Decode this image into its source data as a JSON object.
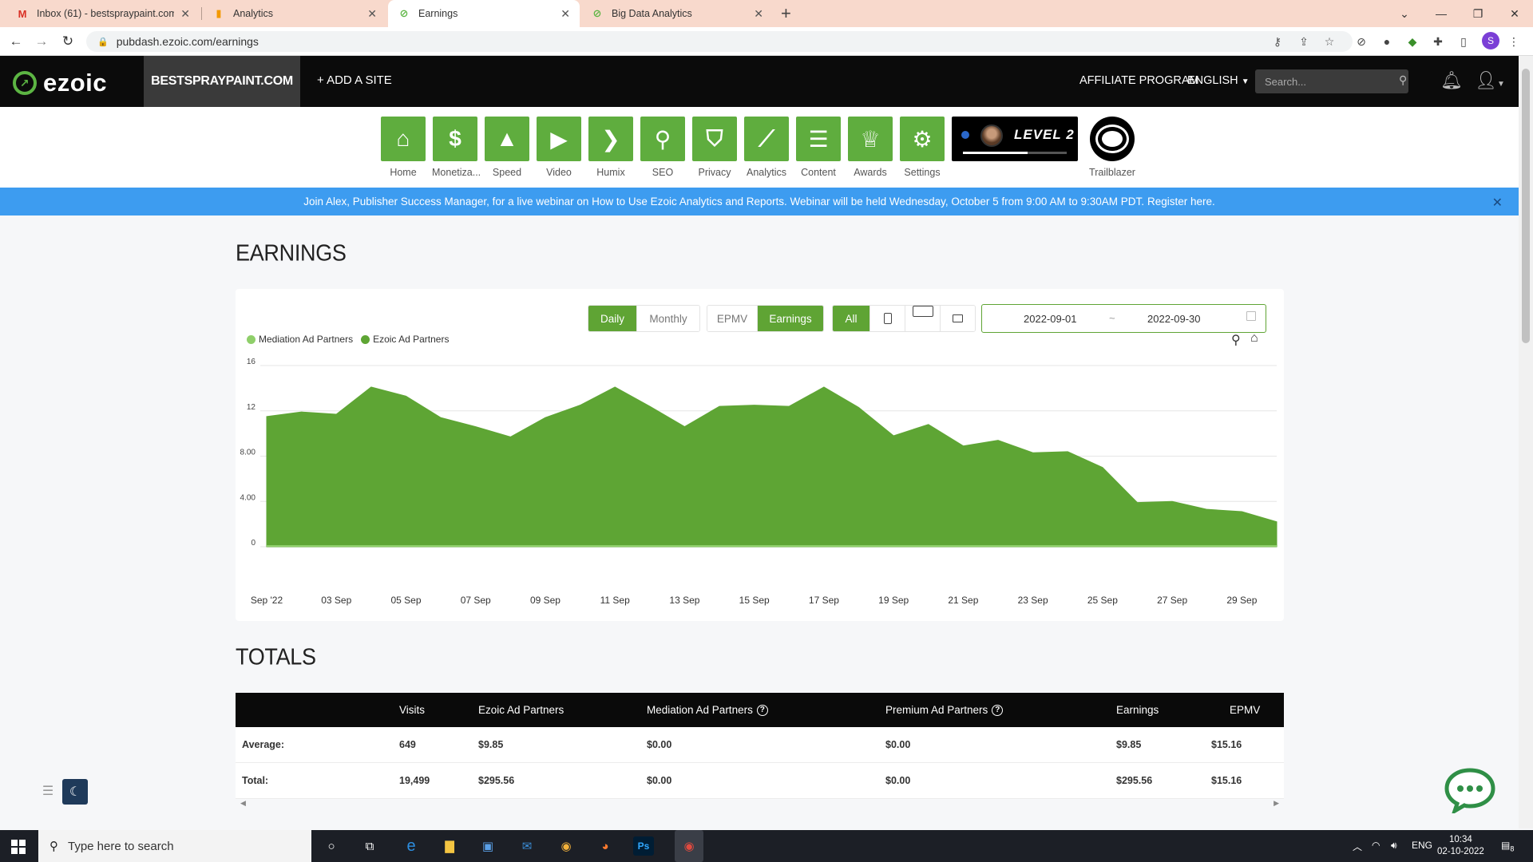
{
  "browser": {
    "tabs": [
      {
        "label": "Inbox (61) - bestspraypaint.com@",
        "icon": "gmail-icon"
      },
      {
        "label": "Analytics",
        "icon": "analytics-icon"
      },
      {
        "label": "Earnings",
        "icon": "ezoic-icon",
        "active": true
      },
      {
        "label": "Big Data Analytics",
        "icon": "ezoic-icon"
      }
    ],
    "url": "pubdash.ezoic.com/earnings",
    "profile_initial": "S"
  },
  "header": {
    "logo": "ezoic",
    "site": "BESTSPRAYPAINT.COM",
    "add_site": "+ ADD A SITE",
    "affiliate": "AFFILIATE PROGRAM",
    "language": "ENGLISH",
    "search_placeholder": "Search..."
  },
  "apps": [
    {
      "label": "Home",
      "icon": "home-icon"
    },
    {
      "label": "Monetiza...",
      "icon": "dollar-icon"
    },
    {
      "label": "Speed",
      "icon": "rocket-icon"
    },
    {
      "label": "Video",
      "icon": "video-icon"
    },
    {
      "label": "Humix",
      "icon": "humix-chevron-icon"
    },
    {
      "label": "SEO",
      "icon": "magnifier-icon"
    },
    {
      "label": "Privacy",
      "icon": "shield-icon"
    },
    {
      "label": "Analytics",
      "icon": "line-chart-icon"
    },
    {
      "label": "Content",
      "icon": "document-icon"
    },
    {
      "label": "Awards",
      "icon": "trophy-icon"
    },
    {
      "label": "Settings",
      "icon": "gear-icon"
    }
  ],
  "level": {
    "label": "LEVEL 2",
    "progress": 0.62
  },
  "trailblazer": {
    "label": "Trailblazer"
  },
  "banner": {
    "text": "Join Alex, Publisher Success Manager, for a live webinar on How to Use Ezoic Analytics and Reports. Webinar will be held Wednesday, October 5 from 9:00 AM to 9:30AM PDT.",
    "link": "Register here."
  },
  "earnings": {
    "title": "EARNINGS",
    "period_buttons": [
      "Daily",
      "Monthly"
    ],
    "metric_buttons": [
      "EPMV",
      "Earnings"
    ],
    "device_all": "All",
    "date_from": "2022-09-01",
    "date_sep": "~",
    "date_to": "2022-09-30"
  },
  "chart_data": {
    "type": "area",
    "title": "",
    "xlabel": "",
    "ylabel": "",
    "x": [
      "Sep '22",
      "02 Sep",
      "03 Sep",
      "04 Sep",
      "05 Sep",
      "06 Sep",
      "07 Sep",
      "08 Sep",
      "09 Sep",
      "10 Sep",
      "11 Sep",
      "12 Sep",
      "13 Sep",
      "14 Sep",
      "15 Sep",
      "16 Sep",
      "17 Sep",
      "18 Sep",
      "19 Sep",
      "20 Sep",
      "21 Sep",
      "22 Sep",
      "23 Sep",
      "24 Sep",
      "25 Sep",
      "26 Sep",
      "27 Sep",
      "28 Sep",
      "29 Sep",
      "30 Sep"
    ],
    "xtick_labels": [
      "Sep '22",
      "03 Sep",
      "05 Sep",
      "07 Sep",
      "09 Sep",
      "11 Sep",
      "13 Sep",
      "15 Sep",
      "17 Sep",
      "19 Sep",
      "21 Sep",
      "23 Sep",
      "25 Sep",
      "27 Sep",
      "29 Sep"
    ],
    "ytick_labels": [
      "0",
      "4.00",
      "8.00",
      "12",
      "16"
    ],
    "ylim": [
      0,
      16
    ],
    "legend": "top-left",
    "grid": true,
    "series": [
      {
        "name": "Mediation Ad Partners",
        "color": "#8fcf6a",
        "values": [
          0,
          0,
          0,
          0,
          0,
          0,
          0,
          0,
          0,
          0,
          0,
          0,
          0,
          0,
          0,
          0,
          0,
          0,
          0,
          0,
          0,
          0,
          0,
          0,
          0,
          0,
          0,
          0,
          0,
          0
        ]
      },
      {
        "name": "Ezoic Ad Partners",
        "color": "#5ea534",
        "values": [
          11.5,
          11.9,
          11.7,
          14.1,
          13.3,
          11.4,
          10.6,
          9.7,
          11.4,
          12.5,
          14.1,
          12.4,
          10.6,
          12.4,
          12.5,
          12.4,
          14.1,
          12.3,
          9.8,
          10.8,
          8.9,
          9.4,
          8.3,
          8.4,
          7.0,
          3.9,
          4.0,
          3.3,
          3.1,
          2.2
        ]
      }
    ]
  },
  "totals": {
    "title": "TOTALS",
    "columns": [
      "",
      "Visits",
      "Ezoic Ad Partners",
      "Mediation Ad Partners",
      "Premium Ad Partners",
      "Earnings",
      "EPMV"
    ],
    "rows": [
      {
        "label": "Average:",
        "visits": "649",
        "ezoic": "$9.85",
        "mediation": "$0.00",
        "premium": "$0.00",
        "earnings": "$9.85",
        "epmv": "$15.16"
      },
      {
        "label": "Total:",
        "visits": "19,499",
        "ezoic": "$295.56",
        "mediation": "$0.00",
        "premium": "$0.00",
        "earnings": "$295.56",
        "epmv": "$15.16"
      }
    ]
  },
  "taskbar": {
    "search_placeholder": "Type here to search",
    "language": "ENG",
    "time": "10:34",
    "date": "02-10-2022",
    "notifications": "8"
  }
}
